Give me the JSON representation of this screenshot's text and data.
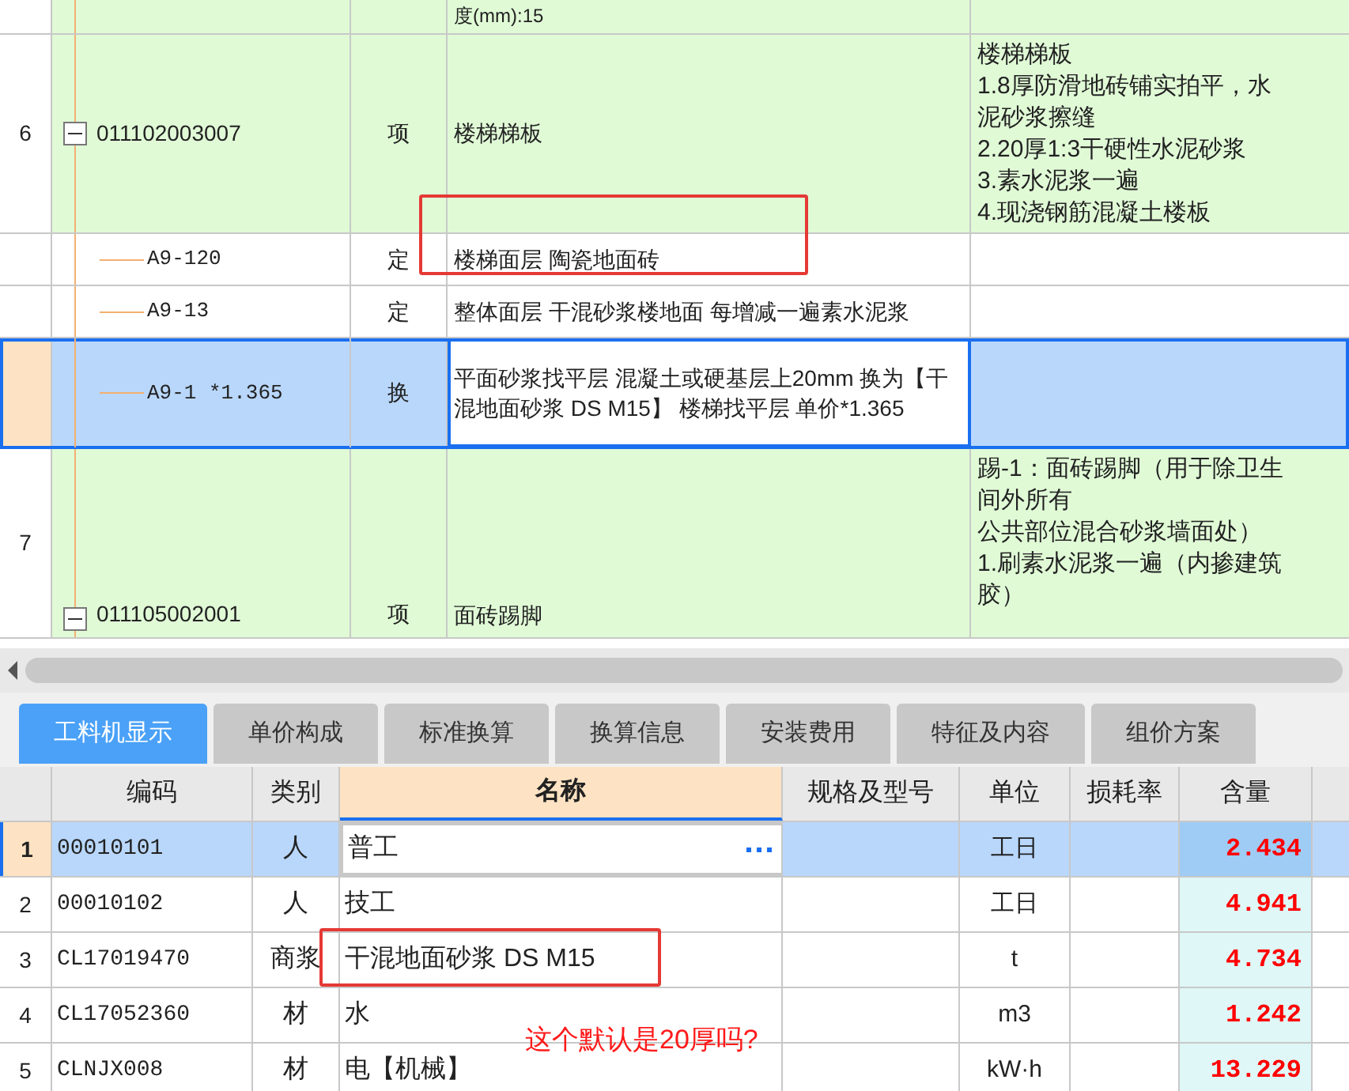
{
  "upper_table": {
    "rows": [
      {
        "kind": "cut",
        "index": "",
        "code": "",
        "type": "",
        "name": "度(mm):15",
        "features": [],
        "selected": false,
        "highlighted": false
      },
      {
        "kind": "item",
        "index": "6",
        "code": "011102003007",
        "type": "项",
        "name": "楼梯梯板",
        "features": [
          "楼梯梯板",
          "1.8厚防滑地砖铺实拍平，水",
          "泥砂浆擦缝",
          "2.20厚1:3干硬性水泥砂浆",
          "3.素水泥浆一遍",
          "4.现浇钢筋混凝土楼板"
        ],
        "expanded": true,
        "selected": false,
        "highlighted": false
      },
      {
        "kind": "sub",
        "index": "",
        "code": "A9-120",
        "type": "定",
        "name": "楼梯面层 陶瓷地面砖",
        "features": [],
        "selected": false,
        "highlighted": true
      },
      {
        "kind": "sub",
        "index": "",
        "code": "A9-13",
        "type": "定",
        "name": "整体面层 干混砂浆楼地面 每增减一遍素水泥浆",
        "features": [],
        "selected": false,
        "highlighted": false
      },
      {
        "kind": "sub",
        "index": "",
        "code": "A9-1 *1.365",
        "type": "换",
        "name": "平面砂浆找平层 混凝土或硬基层上20mm  换为【干混地面砂浆 DS M15】  楼梯找平层 单价*1.365",
        "features": [],
        "selected": true,
        "highlighted": false
      },
      {
        "kind": "item",
        "index": "7",
        "code": "011105002001",
        "type": "项",
        "name": "面砖踢脚",
        "features": [
          "踢-1：面砖踢脚（用于除卫生",
          "间外所有",
          "公共部位混合砂浆墙面处）",
          "1.刷素水泥浆一遍（内掺建筑",
          "胶）"
        ],
        "expanded": true,
        "selected": false,
        "highlighted": false
      }
    ]
  },
  "tabs": [
    {
      "label": "工料机显示",
      "selected": true
    },
    {
      "label": "单价构成",
      "selected": false
    },
    {
      "label": "标准换算",
      "selected": false
    },
    {
      "label": "换算信息",
      "selected": false
    },
    {
      "label": "安装费用",
      "selected": false
    },
    {
      "label": "特征及内容",
      "selected": false
    },
    {
      "label": "组价方案",
      "selected": false
    }
  ],
  "lower_table": {
    "columns": [
      "编码",
      "类别",
      "名称",
      "规格及型号",
      "单位",
      "损耗率",
      "含量"
    ],
    "rows": [
      {
        "index": "1",
        "code": "00010101",
        "type": "人",
        "name": "普工",
        "unit": "工日",
        "quantity": "2.434",
        "selected": true,
        "highlighted": false
      },
      {
        "index": "2",
        "code": "00010102",
        "type": "人",
        "name": "技工",
        "unit": "工日",
        "quantity": "4.941",
        "selected": false,
        "highlighted": false
      },
      {
        "index": "3",
        "code": "CL17019470",
        "type": "商浆",
        "name": "干混地面砂浆 DS M15",
        "unit": "t",
        "quantity": "4.734",
        "selected": false,
        "highlighted": true
      },
      {
        "index": "4",
        "code": "CL17052360",
        "type": "材",
        "name": "水",
        "unit": "m3",
        "quantity": "1.242",
        "selected": false,
        "highlighted": false
      },
      {
        "index": "5",
        "code": "CLNJX008",
        "type": "材",
        "name": "电【机械】",
        "unit": "kW·h",
        "quantity": "13.229",
        "selected": false,
        "highlighted": false
      }
    ]
  },
  "annotation": "这个默认是20厚吗?"
}
